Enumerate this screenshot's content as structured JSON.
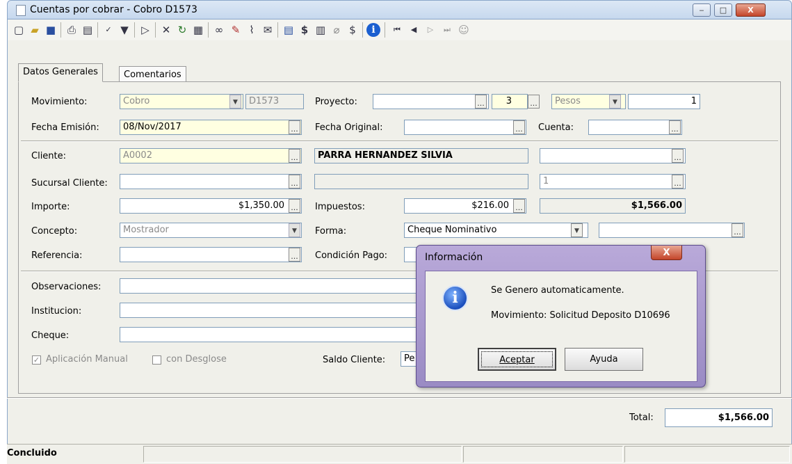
{
  "window": {
    "title": "Cuentas por cobrar - Cobro D1573",
    "controls": {
      "minimize": "‒",
      "maximize": "□",
      "close": "X"
    }
  },
  "tabs": [
    {
      "label": "Datos Generales",
      "active": true
    },
    {
      "label": "Comentarios",
      "active": false
    }
  ],
  "form": {
    "movimiento": {
      "label": "Movimiento:",
      "value": "Cobro",
      "id": "D1573"
    },
    "proyecto": {
      "label": "Proyecto:",
      "value": "",
      "num": "3"
    },
    "moneda": {
      "value": "Pesos",
      "tipo_cambio": "1"
    },
    "fecha_emision": {
      "label": "Fecha Emisión:",
      "value": "08/Nov/2017"
    },
    "fecha_original": {
      "label": "Fecha Original:",
      "value": ""
    },
    "cuenta": {
      "label": "Cuenta:",
      "value": ""
    },
    "cliente": {
      "label": "Cliente:",
      "value": "A0002",
      "nombre": "PARRA HERNANDEZ SILVIA",
      "extra": ""
    },
    "sucursal_cliente": {
      "label": "Sucursal Cliente:",
      "value": "",
      "desc": "",
      "num": "1"
    },
    "importe": {
      "label": "Importe:",
      "value": "$1,350.00"
    },
    "impuestos": {
      "label": "Impuestos:",
      "value": "$216.00",
      "total": "$1,566.00"
    },
    "concepto": {
      "label": "Concepto:",
      "value": "Mostrador"
    },
    "forma": {
      "label": "Forma:",
      "value": "Cheque Nominativo",
      "extra": ""
    },
    "referencia": {
      "label": "Referencia:",
      "value": ""
    },
    "condicion_pago": {
      "label": "Condición Pago:",
      "value": ""
    },
    "observaciones": {
      "label": "Observaciones:",
      "value": ""
    },
    "institucion": {
      "label": "Institucion:",
      "value": ""
    },
    "cheque": {
      "label": "Cheque:",
      "value": ""
    },
    "aplicacion_manual": {
      "label": "Aplicación Manual",
      "checked": true
    },
    "con_desglose": {
      "label": "con Desglose",
      "checked": false
    },
    "saldo_cliente": {
      "label": "Saldo Cliente:",
      "value": "Pe"
    }
  },
  "totals": {
    "label": "Total:",
    "value": "$1,566.00"
  },
  "status": {
    "text": "Concluido"
  },
  "dialog": {
    "title": "Información",
    "close": "X",
    "message1": "Se Genero automaticamente.",
    "message2": "Movimiento: Solicitud Deposito D10696",
    "ok_label": "Aceptar",
    "help_label": "Ayuda",
    "icon": "information-icon"
  },
  "colors": {
    "required_field": "#ffffe1",
    "dialog_frame": "#9a8bc4",
    "title_bar": "#c6d8ee"
  }
}
